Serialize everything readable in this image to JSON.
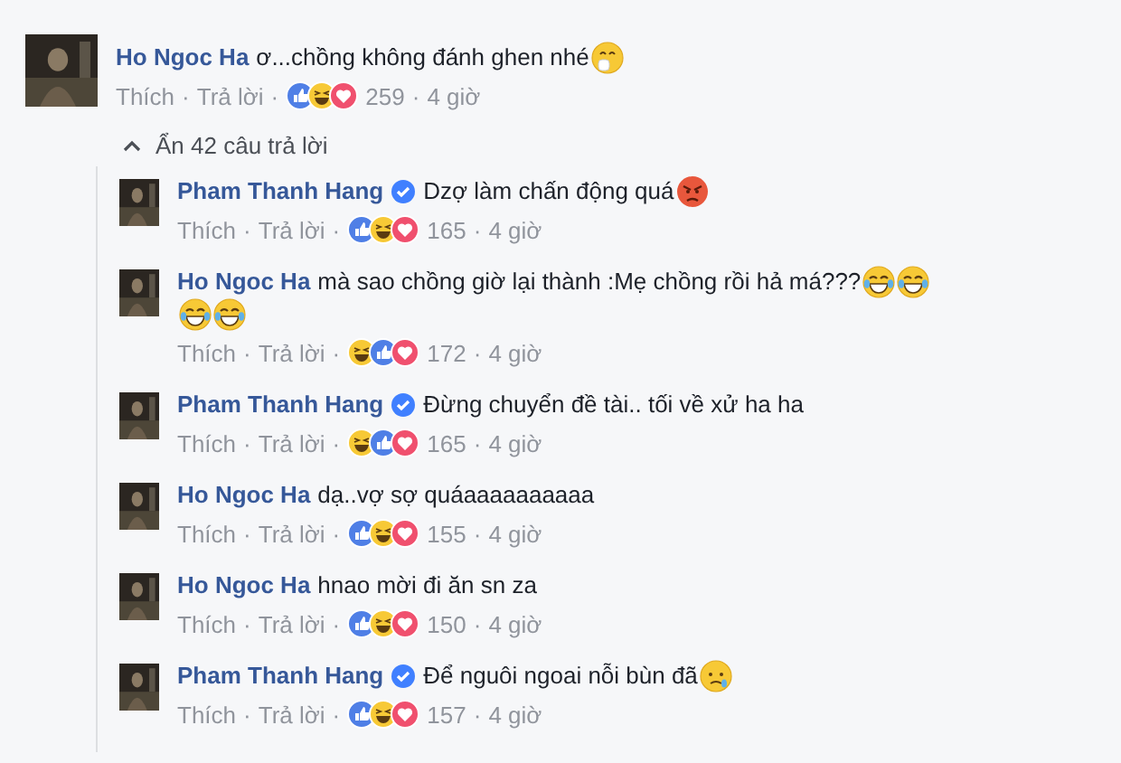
{
  "comment": {
    "author": "Ho Ngoc Ha",
    "verified": false,
    "text": "ơ...chồng không đánh ghen nhé",
    "emoji": [
      {
        "kind": "hand-over-mouth"
      }
    ],
    "actions": [
      {
        "kind": "like",
        "text": "Thích"
      },
      {
        "kind": "separator",
        "text": "·"
      },
      {
        "kind": "reply",
        "text": "Trả lời"
      },
      {
        "kind": "separator",
        "text": "·"
      }
    ],
    "reactions": [
      {
        "kind": "like"
      },
      {
        "kind": "haha"
      },
      {
        "kind": "love"
      }
    ],
    "reaction_count": "259",
    "time_separator": "·",
    "time": "4 giờ"
  },
  "toggle_replies": {
    "label": "Ẩn 42 câu trả lời",
    "expanded": true
  },
  "replies": [
    {
      "author": "Pham Thanh Hang",
      "verified": true,
      "text": "Dzợ làm chấn động quá",
      "emoji": [
        {
          "kind": "angry"
        }
      ],
      "actions": [
        {
          "kind": "like",
          "text": "Thích"
        },
        {
          "kind": "separator",
          "text": "·"
        },
        {
          "kind": "reply",
          "text": "Trả lời"
        },
        {
          "kind": "separator",
          "text": "·"
        }
      ],
      "reactions": [
        {
          "kind": "like"
        },
        {
          "kind": "haha"
        },
        {
          "kind": "love"
        }
      ],
      "reaction_count": "165",
      "time_separator": "·",
      "time": "4 giờ"
    },
    {
      "author": "Ho Ngoc Ha",
      "verified": false,
      "text": "mà sao chồng giờ lại thành :Mẹ chồng rồi hả má???",
      "emoji": [
        {
          "kind": "tears-of-joy"
        },
        {
          "kind": "tears-of-joy"
        },
        {
          "kind": "tears-of-joy"
        },
        {
          "kind": "tears-of-joy"
        }
      ],
      "actions": [
        {
          "kind": "like",
          "text": "Thích"
        },
        {
          "kind": "separator",
          "text": "·"
        },
        {
          "kind": "reply",
          "text": "Trả lời"
        },
        {
          "kind": "separator",
          "text": "·"
        }
      ],
      "reactions": [
        {
          "kind": "haha"
        },
        {
          "kind": "like"
        },
        {
          "kind": "love"
        }
      ],
      "reaction_count": "172",
      "time_separator": "·",
      "time": "4 giờ"
    },
    {
      "author": "Pham Thanh Hang",
      "verified": true,
      "text": "Đừng chuyển đề tài.. tối về xử ha ha",
      "actions": [
        {
          "kind": "like",
          "text": "Thích"
        },
        {
          "kind": "separator",
          "text": "·"
        },
        {
          "kind": "reply",
          "text": "Trả lời"
        },
        {
          "kind": "separator",
          "text": "·"
        }
      ],
      "reactions": [
        {
          "kind": "haha"
        },
        {
          "kind": "like"
        },
        {
          "kind": "love"
        }
      ],
      "reaction_count": "165",
      "time_separator": "·",
      "time": "4 giờ"
    },
    {
      "author": "Ho Ngoc Ha",
      "verified": false,
      "text": "dạ..vợ sợ quáaaaaaaaaaa",
      "actions": [
        {
          "kind": "like",
          "text": "Thích"
        },
        {
          "kind": "separator",
          "text": "·"
        },
        {
          "kind": "reply",
          "text": "Trả lời"
        },
        {
          "kind": "separator",
          "text": "·"
        }
      ],
      "reactions": [
        {
          "kind": "like"
        },
        {
          "kind": "haha"
        },
        {
          "kind": "love"
        }
      ],
      "reaction_count": "155",
      "time_separator": "·",
      "time": "4 giờ"
    },
    {
      "author": "Ho Ngoc Ha",
      "verified": false,
      "text": "hnao mời đi ăn sn za",
      "actions": [
        {
          "kind": "like",
          "text": "Thích"
        },
        {
          "kind": "separator",
          "text": "·"
        },
        {
          "kind": "reply",
          "text": "Trả lời"
        },
        {
          "kind": "separator",
          "text": "·"
        }
      ],
      "reactions": [
        {
          "kind": "like"
        },
        {
          "kind": "haha"
        },
        {
          "kind": "love"
        }
      ],
      "reaction_count": "150",
      "time_separator": "·",
      "time": "4 giờ"
    },
    {
      "author": "Pham Thanh Hang",
      "verified": true,
      "text": "Để nguôi ngoai nỗi bùn đã",
      "emoji": [
        {
          "kind": "sad-tear"
        }
      ],
      "actions": [
        {
          "kind": "like",
          "text": "Thích"
        },
        {
          "kind": "separator",
          "text": "·"
        },
        {
          "kind": "reply",
          "text": "Trả lời"
        },
        {
          "kind": "separator",
          "text": "·"
        }
      ],
      "reactions": [
        {
          "kind": "like"
        },
        {
          "kind": "haha"
        },
        {
          "kind": "love"
        }
      ],
      "reaction_count": "157",
      "time_separator": "·",
      "time": "4 giờ"
    }
  ]
}
